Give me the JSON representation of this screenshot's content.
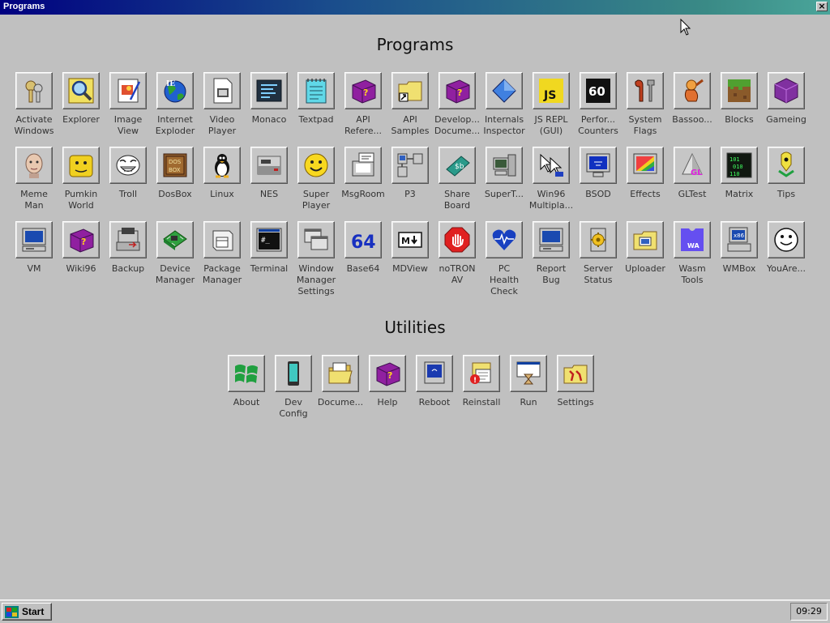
{
  "window": {
    "title": "Programs",
    "close_label": "×"
  },
  "sections": {
    "programs_title": "Programs",
    "utilities_title": "Utilities"
  },
  "programs": [
    {
      "label": "Activate\nWindows",
      "icon": "keys-icon"
    },
    {
      "label": "Explorer",
      "icon": "magnifier-icon"
    },
    {
      "label": "Image\nView",
      "icon": "image-view-icon"
    },
    {
      "label": "Internet\nExploder",
      "icon": "globe-icon"
    },
    {
      "label": "Video\nPlayer",
      "icon": "video-file-icon"
    },
    {
      "label": "Monaco",
      "icon": "monaco-icon"
    },
    {
      "label": "Textpad",
      "icon": "notepad-icon"
    },
    {
      "label": "API\nRefere...",
      "icon": "help-book-icon"
    },
    {
      "label": "API\nSamples",
      "icon": "folder-shortcut-icon"
    },
    {
      "label": "Develop...\nDocume...",
      "icon": "help-book-icon"
    },
    {
      "label": "Internals\nInspector",
      "icon": "blue-diamond-icon"
    },
    {
      "label": "JS REPL\n(GUI)",
      "icon": "js-icon",
      "text": "JS"
    },
    {
      "label": "Perfor...\nCounters",
      "icon": "counter-icon",
      "text": "60"
    },
    {
      "label": "System\nFlags",
      "icon": "tools-icon"
    },
    {
      "label": "Bassoo...",
      "icon": "bassoon-icon"
    },
    {
      "label": "Blocks",
      "icon": "grass-block-icon"
    },
    {
      "label": "Gameing",
      "icon": "purple-cube-icon"
    },
    {
      "label": "Meme\nMan",
      "icon": "meme-man-icon"
    },
    {
      "label": "Pumkin\nWorld",
      "icon": "pumpkin-icon"
    },
    {
      "label": "Troll",
      "icon": "troll-face-icon"
    },
    {
      "label": "DosBox",
      "icon": "dosbox-icon"
    },
    {
      "label": "Linux",
      "icon": "penguin-icon"
    },
    {
      "label": "NES",
      "icon": "nes-icon"
    },
    {
      "label": "Super\nPlayer",
      "icon": "smiley-icon"
    },
    {
      "label": "MsgRoom",
      "icon": "message-computer-icon"
    },
    {
      "label": "P3",
      "icon": "network-icon"
    },
    {
      "label": "Share\nBoard",
      "icon": "share-board-icon"
    },
    {
      "label": "SuperT...",
      "icon": "computer-tower-icon"
    },
    {
      "label": "Win96\nMultipla...",
      "icon": "cursors-icon"
    },
    {
      "label": "BSOD",
      "icon": "monitor-icon"
    },
    {
      "label": "Effects",
      "icon": "rainbow-monitor-icon"
    },
    {
      "label": "GLTest",
      "icon": "gl-cone-icon",
      "text": "GL"
    },
    {
      "label": "Matrix",
      "icon": "matrix-icon"
    },
    {
      "label": "Tips",
      "icon": "tips-icon"
    },
    {
      "label": "VM",
      "icon": "computer-icon"
    },
    {
      "label": "Wiki96",
      "icon": "help-book-icon"
    },
    {
      "label": "Backup",
      "icon": "backup-icon"
    },
    {
      "label": "Device\nManager",
      "icon": "circuit-board-icon"
    },
    {
      "label": "Package\nManager",
      "icon": "package-icon"
    },
    {
      "label": "Terminal",
      "icon": "terminal-icon"
    },
    {
      "label": "Window\nManager\nSettings",
      "icon": "windows-icon"
    },
    {
      "label": "Base64",
      "icon": "base64-icon",
      "text": "64"
    },
    {
      "label": "MDView",
      "icon": "markdown-icon"
    },
    {
      "label": "noTRON\nAV",
      "icon": "stop-hand-icon"
    },
    {
      "label": "PC\nHealth\nCheck",
      "icon": "heart-icon"
    },
    {
      "label": "Report\nBug",
      "icon": "computer-icon"
    },
    {
      "label": "Server\nStatus",
      "icon": "server-gear-icon"
    },
    {
      "label": "Uploader",
      "icon": "upload-folder-icon"
    },
    {
      "label": "Wasm\nTools",
      "icon": "wasm-icon",
      "text": "WA"
    },
    {
      "label": "WMBox",
      "icon": "x86-computer-icon"
    },
    {
      "label": "YouAre...",
      "icon": "smiley-face-outline-icon"
    }
  ],
  "utilities": [
    {
      "label": "About",
      "icon": "windows-flag-icon"
    },
    {
      "label": "Dev\nConfig",
      "icon": "phone-icon"
    },
    {
      "label": "Docume...",
      "icon": "open-folder-icon"
    },
    {
      "label": "Help",
      "icon": "help-book-icon"
    },
    {
      "label": "Reboot",
      "icon": "reboot-monitor-icon"
    },
    {
      "label": "Reinstall",
      "icon": "reinstall-icon"
    },
    {
      "label": "Run",
      "icon": "run-icon"
    },
    {
      "label": "Settings",
      "icon": "settings-folder-icon"
    }
  ],
  "taskbar": {
    "start_label": "Start",
    "clock": "09:29"
  }
}
